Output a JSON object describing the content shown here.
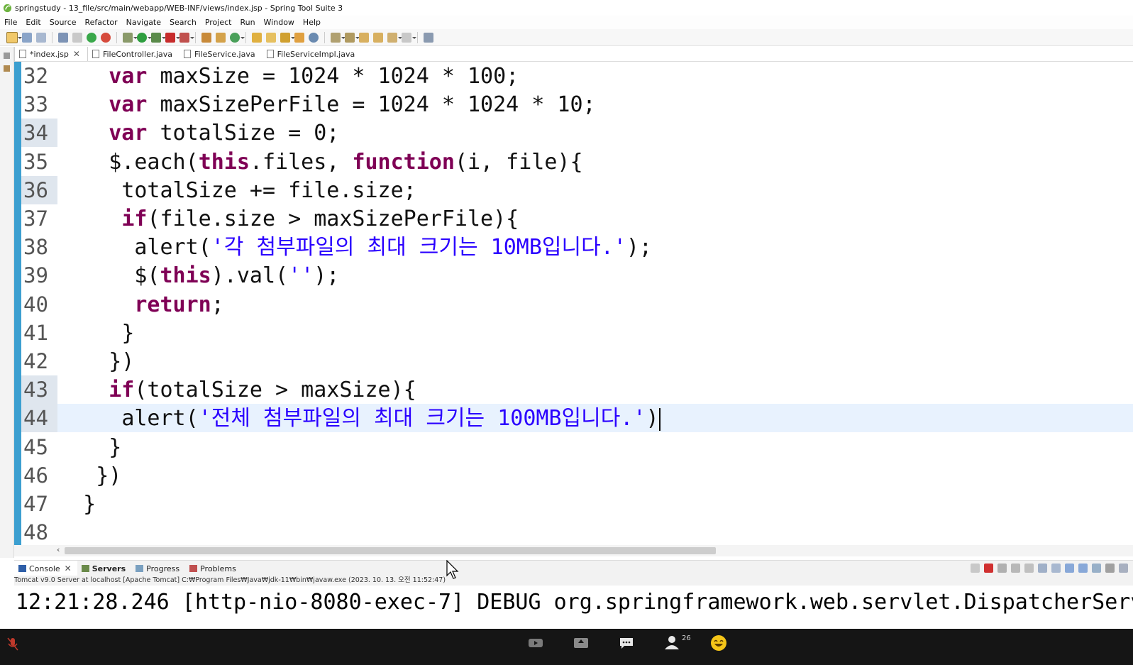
{
  "window": {
    "title": "springstudy - 13_file/src/main/webapp/WEB-INF/views/index.jsp - Spring Tool Suite 3"
  },
  "menu": [
    "File",
    "Edit",
    "Source",
    "Refactor",
    "Navigate",
    "Search",
    "Project",
    "Run",
    "Window",
    "Help"
  ],
  "editor_tabs": [
    {
      "label": "*index.jsp",
      "active": true,
      "closable": true
    },
    {
      "label": "FileController.java",
      "active": false
    },
    {
      "label": "FileService.java",
      "active": false
    },
    {
      "label": "FileServiceImpl.java",
      "active": false
    }
  ],
  "code_lines": [
    {
      "n": "32",
      "code": "var maxSize = 1024 * 1024 * 100;"
    },
    {
      "n": "33",
      "code": "var maxSizePerFile = 1024 * 1024 * 10;"
    },
    {
      "n": "34",
      "code": "var totalSize = 0;"
    },
    {
      "n": "35",
      "code": "$.each(this.files, function(i, file){"
    },
    {
      "n": "36",
      "code": "totalSize += file.size;"
    },
    {
      "n": "37",
      "code": "if(file.size > maxSizePerFile){"
    },
    {
      "n": "38",
      "code": "alert('각 첨부파일의 최대 크기는 10MB입니다.');"
    },
    {
      "n": "39",
      "code": "$(this).val('');"
    },
    {
      "n": "40",
      "code": "return;"
    },
    {
      "n": "41",
      "code": "}"
    },
    {
      "n": "42",
      "code": "})"
    },
    {
      "n": "43",
      "code": "if(totalSize > maxSize){"
    },
    {
      "n": "44",
      "code": "alert('전체 첨부파일의 최대 크기는 100MB입니다.')"
    },
    {
      "n": "45",
      "code": "}"
    },
    {
      "n": "46",
      "code": "})"
    },
    {
      "n": "47",
      "code": "}"
    },
    {
      "n": "48",
      "code": ""
    }
  ],
  "console": {
    "tabs": [
      {
        "label": "Console",
        "active": true,
        "closable": true
      },
      {
        "label": "Servers",
        "active": false,
        "bold": true
      },
      {
        "label": "Progress",
        "active": false
      },
      {
        "label": "Problems",
        "active": false
      }
    ],
    "description": "Tomcat v9.0 Server at localhost [Apache Tomcat] C:₩Program Files₩Java₩jdk-11₩bin₩javaw.exe  (2023. 10. 13. 오전 11:52:47)",
    "output": "12:21:28.246 [http-nio-8080-exec-7] DEBUG org.springframework.web.servlet.DispatcherServ"
  },
  "taskbar": {
    "participants_count": "26"
  },
  "colors": {
    "keyword": "#7f0055",
    "string": "#2a00ff",
    "current_line": "#e8f2fe",
    "ruler": "#3c9fd0"
  }
}
